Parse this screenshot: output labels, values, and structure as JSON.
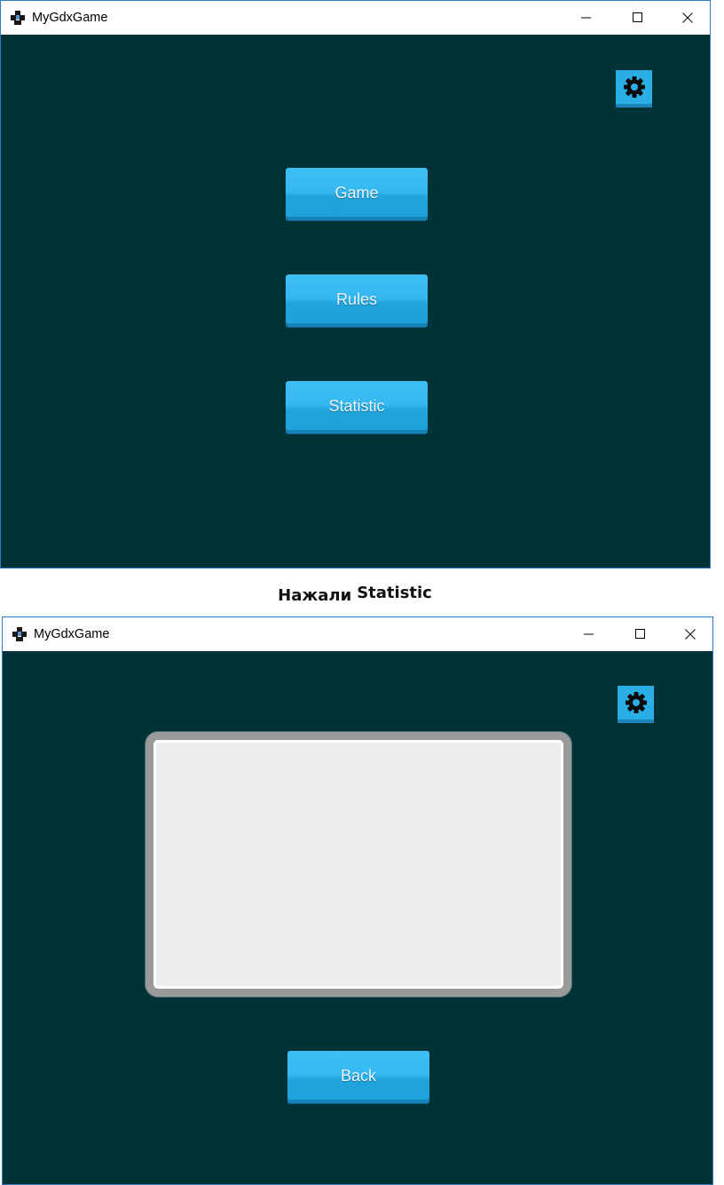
{
  "window1": {
    "title": "MyGdxGame",
    "buttons": [
      "Game",
      "Rules",
      "Statistic"
    ]
  },
  "caption": {
    "prefix": "Нажали",
    "word": "Statistic"
  },
  "window2": {
    "title": "MyGdxGame",
    "back_label": "Back"
  },
  "icons": {
    "settings": "gear-icon",
    "app": "libgdx-logo-icon"
  },
  "colors": {
    "background": "#003236",
    "button": "#29aee6",
    "panel": "#ececec",
    "window_border": "#2b78c6"
  }
}
